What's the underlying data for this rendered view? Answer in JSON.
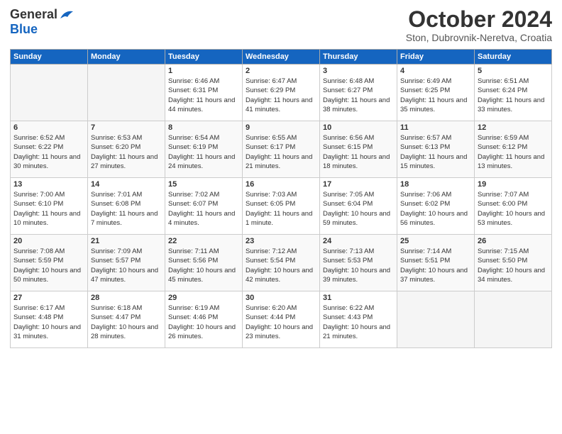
{
  "header": {
    "logo_general": "General",
    "logo_blue": "Blue",
    "month_title": "October 2024",
    "location": "Ston, Dubrovnik-Neretva, Croatia"
  },
  "days_of_week": [
    "Sunday",
    "Monday",
    "Tuesday",
    "Wednesday",
    "Thursday",
    "Friday",
    "Saturday"
  ],
  "weeks": [
    [
      {
        "num": "",
        "info": ""
      },
      {
        "num": "",
        "info": ""
      },
      {
        "num": "1",
        "info": "Sunrise: 6:46 AM\nSunset: 6:31 PM\nDaylight: 11 hours and 44 minutes."
      },
      {
        "num": "2",
        "info": "Sunrise: 6:47 AM\nSunset: 6:29 PM\nDaylight: 11 hours and 41 minutes."
      },
      {
        "num": "3",
        "info": "Sunrise: 6:48 AM\nSunset: 6:27 PM\nDaylight: 11 hours and 38 minutes."
      },
      {
        "num": "4",
        "info": "Sunrise: 6:49 AM\nSunset: 6:25 PM\nDaylight: 11 hours and 35 minutes."
      },
      {
        "num": "5",
        "info": "Sunrise: 6:51 AM\nSunset: 6:24 PM\nDaylight: 11 hours and 33 minutes."
      }
    ],
    [
      {
        "num": "6",
        "info": "Sunrise: 6:52 AM\nSunset: 6:22 PM\nDaylight: 11 hours and 30 minutes."
      },
      {
        "num": "7",
        "info": "Sunrise: 6:53 AM\nSunset: 6:20 PM\nDaylight: 11 hours and 27 minutes."
      },
      {
        "num": "8",
        "info": "Sunrise: 6:54 AM\nSunset: 6:19 PM\nDaylight: 11 hours and 24 minutes."
      },
      {
        "num": "9",
        "info": "Sunrise: 6:55 AM\nSunset: 6:17 PM\nDaylight: 11 hours and 21 minutes."
      },
      {
        "num": "10",
        "info": "Sunrise: 6:56 AM\nSunset: 6:15 PM\nDaylight: 11 hours and 18 minutes."
      },
      {
        "num": "11",
        "info": "Sunrise: 6:57 AM\nSunset: 6:13 PM\nDaylight: 11 hours and 15 minutes."
      },
      {
        "num": "12",
        "info": "Sunrise: 6:59 AM\nSunset: 6:12 PM\nDaylight: 11 hours and 13 minutes."
      }
    ],
    [
      {
        "num": "13",
        "info": "Sunrise: 7:00 AM\nSunset: 6:10 PM\nDaylight: 11 hours and 10 minutes."
      },
      {
        "num": "14",
        "info": "Sunrise: 7:01 AM\nSunset: 6:08 PM\nDaylight: 11 hours and 7 minutes."
      },
      {
        "num": "15",
        "info": "Sunrise: 7:02 AM\nSunset: 6:07 PM\nDaylight: 11 hours and 4 minutes."
      },
      {
        "num": "16",
        "info": "Sunrise: 7:03 AM\nSunset: 6:05 PM\nDaylight: 11 hours and 1 minute."
      },
      {
        "num": "17",
        "info": "Sunrise: 7:05 AM\nSunset: 6:04 PM\nDaylight: 10 hours and 59 minutes."
      },
      {
        "num": "18",
        "info": "Sunrise: 7:06 AM\nSunset: 6:02 PM\nDaylight: 10 hours and 56 minutes."
      },
      {
        "num": "19",
        "info": "Sunrise: 7:07 AM\nSunset: 6:00 PM\nDaylight: 10 hours and 53 minutes."
      }
    ],
    [
      {
        "num": "20",
        "info": "Sunrise: 7:08 AM\nSunset: 5:59 PM\nDaylight: 10 hours and 50 minutes."
      },
      {
        "num": "21",
        "info": "Sunrise: 7:09 AM\nSunset: 5:57 PM\nDaylight: 10 hours and 47 minutes."
      },
      {
        "num": "22",
        "info": "Sunrise: 7:11 AM\nSunset: 5:56 PM\nDaylight: 10 hours and 45 minutes."
      },
      {
        "num": "23",
        "info": "Sunrise: 7:12 AM\nSunset: 5:54 PM\nDaylight: 10 hours and 42 minutes."
      },
      {
        "num": "24",
        "info": "Sunrise: 7:13 AM\nSunset: 5:53 PM\nDaylight: 10 hours and 39 minutes."
      },
      {
        "num": "25",
        "info": "Sunrise: 7:14 AM\nSunset: 5:51 PM\nDaylight: 10 hours and 37 minutes."
      },
      {
        "num": "26",
        "info": "Sunrise: 7:15 AM\nSunset: 5:50 PM\nDaylight: 10 hours and 34 minutes."
      }
    ],
    [
      {
        "num": "27",
        "info": "Sunrise: 6:17 AM\nSunset: 4:48 PM\nDaylight: 10 hours and 31 minutes."
      },
      {
        "num": "28",
        "info": "Sunrise: 6:18 AM\nSunset: 4:47 PM\nDaylight: 10 hours and 28 minutes."
      },
      {
        "num": "29",
        "info": "Sunrise: 6:19 AM\nSunset: 4:46 PM\nDaylight: 10 hours and 26 minutes."
      },
      {
        "num": "30",
        "info": "Sunrise: 6:20 AM\nSunset: 4:44 PM\nDaylight: 10 hours and 23 minutes."
      },
      {
        "num": "31",
        "info": "Sunrise: 6:22 AM\nSunset: 4:43 PM\nDaylight: 10 hours and 21 minutes."
      },
      {
        "num": "",
        "info": ""
      },
      {
        "num": "",
        "info": ""
      }
    ]
  ]
}
